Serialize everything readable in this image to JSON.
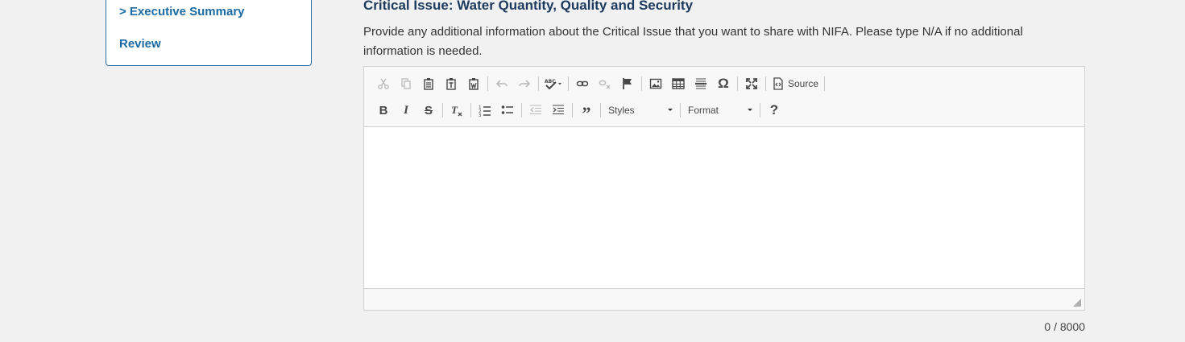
{
  "sidebar": {
    "items": [
      {
        "label": "> Executive Summary"
      },
      {
        "label": "Review"
      }
    ]
  },
  "section": {
    "title": "Critical Issue: Water Quantity, Quality and Security",
    "instructions": "Provide any additional information about the Critical Issue that you want to share with NIFA. Please type N/A if no additional information is needed."
  },
  "editor": {
    "toolbar": {
      "source_label": "Source",
      "styles_label": "Styles",
      "format_label": "Format"
    },
    "char_count": "0 / 8000"
  },
  "colors": {
    "link": "#1b6aa3",
    "title": "#1c3a5e",
    "background": "#f1f1f1"
  }
}
